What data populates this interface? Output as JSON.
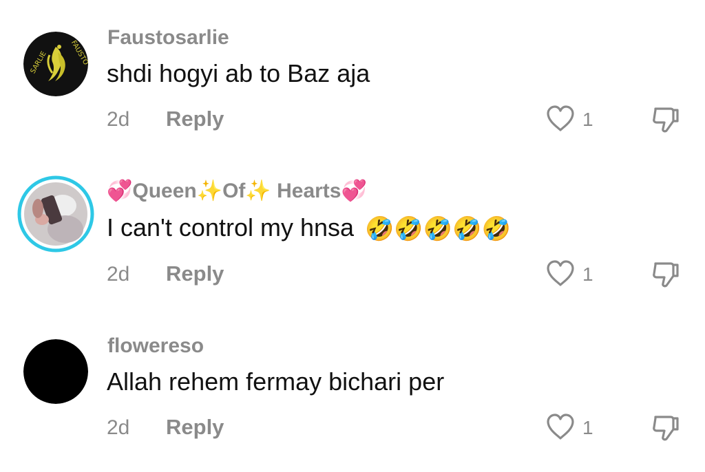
{
  "comments": [
    {
      "username": "Faustosarlie",
      "avatar_icon": "faustosarlie-logo-icon",
      "text": "shdi hogyi ab to Baz aja",
      "time": "2d",
      "reply_label": "Reply",
      "like_count": "1"
    },
    {
      "username_parts": [
        "💞",
        "Queen",
        "✨",
        "Of",
        "✨",
        " Hearts",
        "💞"
      ],
      "avatar_icon": "profile-photo-avatar",
      "text": "I can't control my hnsa",
      "emojis": [
        "🤣",
        "🤣",
        "🤣",
        "🤣",
        "🤣"
      ],
      "time": "2d",
      "reply_label": "Reply",
      "like_count": "1"
    },
    {
      "username": "flowereso",
      "avatar_icon": "black-circle-avatar",
      "text": "Allah rehem fermay bichari per",
      "time": "2d",
      "reply_label": "Reply",
      "like_count": "1"
    }
  ],
  "colors": {
    "meta_gray": "#8a8a8a",
    "text_black": "#111111",
    "story_ring": "#2ec8e6",
    "logo_gold": "#d9cf3a"
  }
}
